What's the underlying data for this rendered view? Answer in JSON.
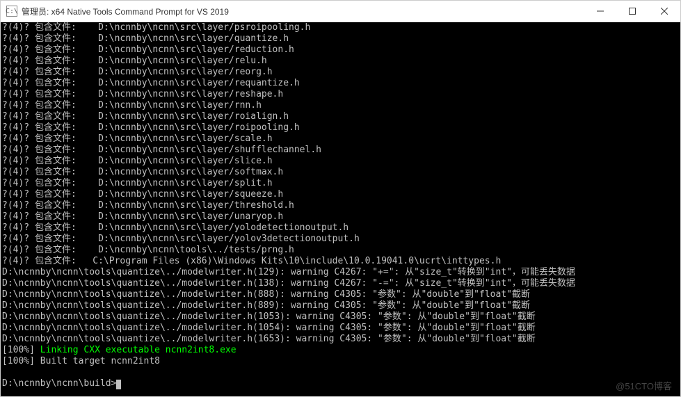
{
  "titlebar": {
    "icon_text": "C:\\",
    "title": "管理员: x64 Native Tools Command Prompt for VS 2019"
  },
  "note_prefix": "?(4)? 包含文件:    ",
  "include_files": [
    "D:\\ncnnby\\ncnn\\src\\layer/psroipooling.h",
    "D:\\ncnnby\\ncnn\\src\\layer/quantize.h",
    "D:\\ncnnby\\ncnn\\src\\layer/reduction.h",
    "D:\\ncnnby\\ncnn\\src\\layer/relu.h",
    "D:\\ncnnby\\ncnn\\src\\layer/reorg.h",
    "D:\\ncnnby\\ncnn\\src\\layer/requantize.h",
    "D:\\ncnnby\\ncnn\\src\\layer/reshape.h",
    "D:\\ncnnby\\ncnn\\src\\layer/rnn.h",
    "D:\\ncnnby\\ncnn\\src\\layer/roialign.h",
    "D:\\ncnnby\\ncnn\\src\\layer/roipooling.h",
    "D:\\ncnnby\\ncnn\\src\\layer/scale.h",
    "D:\\ncnnby\\ncnn\\src\\layer/shufflechannel.h",
    "D:\\ncnnby\\ncnn\\src\\layer/slice.h",
    "D:\\ncnnby\\ncnn\\src\\layer/softmax.h",
    "D:\\ncnnby\\ncnn\\src\\layer/split.h",
    "D:\\ncnnby\\ncnn\\src\\layer/squeeze.h",
    "D:\\ncnnby\\ncnn\\src\\layer/threshold.h",
    "D:\\ncnnby\\ncnn\\src\\layer/unaryop.h",
    "D:\\ncnnby\\ncnn\\src\\layer/yolodetectionoutput.h",
    "D:\\ncnnby\\ncnn\\src\\layer/yolov3detectionoutput.h",
    "D:\\ncnnby\\ncnn\\tools\\../tests/prng.h"
  ],
  "include_last": {
    "prefix": "?(4)? 包含文件:   ",
    "path": "C:\\Program Files (x86)\\Windows Kits\\10\\include\\10.0.19041.0\\ucrt\\inttypes.h"
  },
  "warnings": [
    "D:\\ncnnby\\ncnn\\tools\\quantize\\../modelwriter.h(129): warning C4267: \"+=\": 从\"size_t\"转换到\"int\"，可能丢失数据",
    "D:\\ncnnby\\ncnn\\tools\\quantize\\../modelwriter.h(138): warning C4267: \"-=\": 从\"size_t\"转换到\"int\"，可能丢失数据",
    "D:\\ncnnby\\ncnn\\tools\\quantize\\../modelwriter.h(888): warning C4305: \"参数\": 从\"double\"到\"float\"截断",
    "D:\\ncnnby\\ncnn\\tools\\quantize\\../modelwriter.h(889): warning C4305: \"参数\": 从\"double\"到\"float\"截断",
    "D:\\ncnnby\\ncnn\\tools\\quantize\\../modelwriter.h(1053): warning C4305: \"参数\": 从\"double\"到\"float\"截断",
    "D:\\ncnnby\\ncnn\\tools\\quantize\\../modelwriter.h(1054): warning C4305: \"参数\": 从\"double\"到\"float\"截断",
    "D:\\ncnnby\\ncnn\\tools\\quantize\\../modelwriter.h(1653): warning C4305: \"参数\": 从\"double\"到\"float\"截断"
  ],
  "linking": {
    "percent": "[100%] ",
    "text": "Linking CXX executable ncnn2int8.exe"
  },
  "built": "[100%] Built target ncnn2int8",
  "prompt": "D:\\ncnnby\\ncnn\\build>",
  "watermark": "@51CTO博客"
}
